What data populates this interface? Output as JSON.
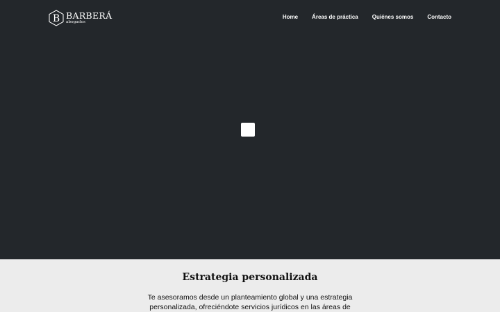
{
  "brand": {
    "initial": "B",
    "name": "BARBERÁ",
    "subtitle": "abogados"
  },
  "nav": {
    "items": [
      {
        "label": "Home"
      },
      {
        "label": "Áreas de práctica"
      },
      {
        "label": "Quiénes somos"
      },
      {
        "label": "Contacto"
      }
    ]
  },
  "section": {
    "title": "Estrategia personalizada",
    "body": "Te asesoramos desde un planteamiento global y una estrategia personalizada, ofreciéndote servicios jurídicos en las áreas de"
  },
  "colors": {
    "hero_background": "#23272b",
    "section_background": "#ececec",
    "nav_text": "#ffffff"
  },
  "icons": {
    "logo": "hexagon-b-icon",
    "video": "video-placeholder"
  }
}
